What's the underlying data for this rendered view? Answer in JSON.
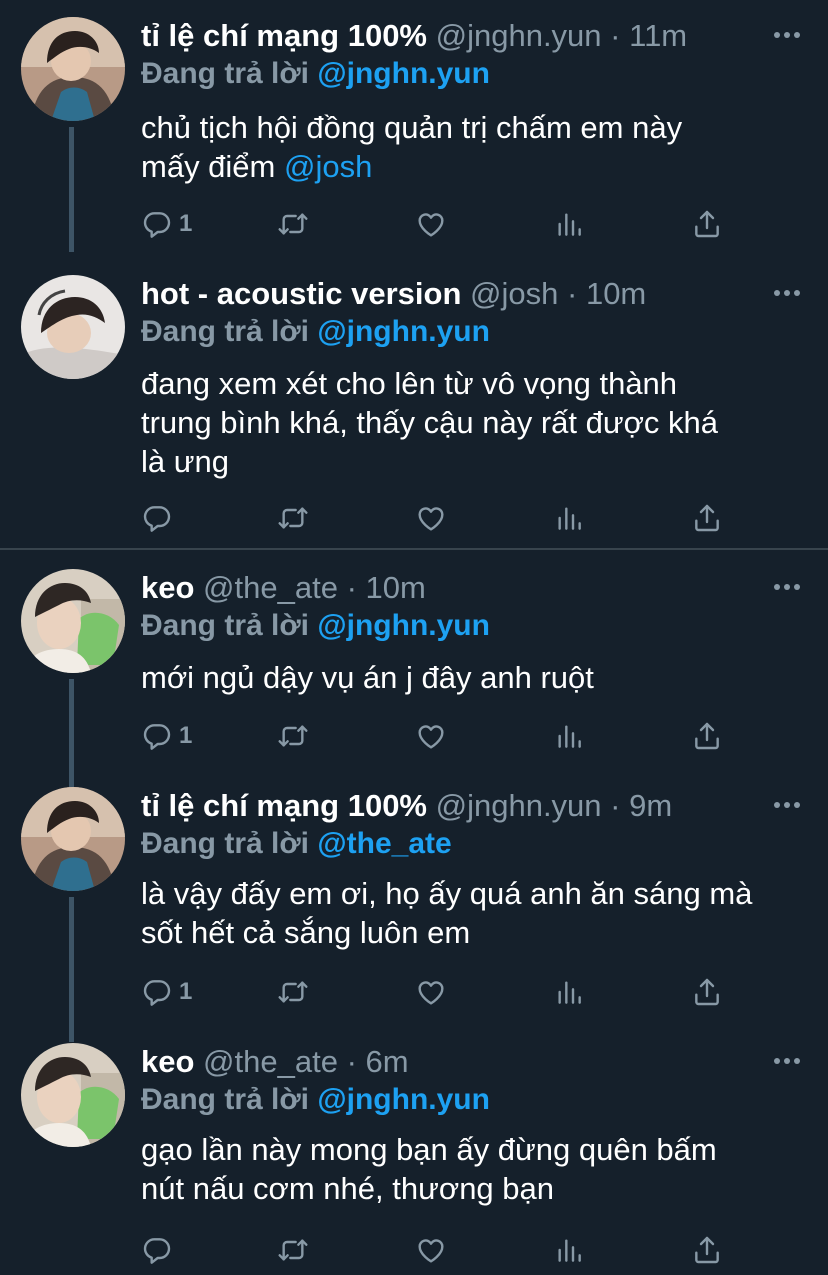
{
  "tweets": [
    {
      "name": "tỉ lệ chí mạng 100%",
      "handle": "@jnghn.yun",
      "time": "11m",
      "reply_prefix": "Đang trả lời",
      "reply_to": "@jnghn.yun",
      "body_lines": [
        "chủ tịch hội đồng quản trị chấm em này",
        "mấy điểm"
      ],
      "body_mention": "@josh",
      "reply_count": "1"
    },
    {
      "name": "hot - acoustic version",
      "handle": "@josh",
      "time": "10m",
      "reply_prefix": "Đang trả lời",
      "reply_to": "@jnghn.yun",
      "body_lines": [
        "đang xem xét cho lên từ vô vọng thành",
        "trung bình khá, thấy cậu này rất được khá",
        "là ưng"
      ],
      "reply_count": ""
    },
    {
      "name": "keo",
      "handle": "@the_ate",
      "time": "10m",
      "reply_prefix": "Đang trả lời",
      "reply_to": "@jnghn.yun",
      "body_lines": [
        "mới ngủ dậy vụ án j đây anh ruột"
      ],
      "reply_count": "1"
    },
    {
      "name": "tỉ lệ chí mạng 100%",
      "handle": "@jnghn.yun",
      "time": "9m",
      "reply_prefix": "Đang trả lời",
      "reply_to": "@the_ate",
      "body_lines": [
        "là vậy đấy em ơi, họ ấy quá anh ăn sáng mà",
        "sốt hết cả sắng luôn em"
      ],
      "reply_count": "1"
    },
    {
      "name": "keo",
      "handle": "@the_ate",
      "time": "6m",
      "reply_prefix": "Đang trả lời",
      "reply_to": "@jnghn.yun",
      "body_lines": [
        "gạo lần này mong bạn ấy đừng quên bấm",
        "nút nấu cơm nhé, thương bạn"
      ],
      "reply_count": ""
    }
  ],
  "separator": "·",
  "icons": [
    "reply-icon",
    "retweet-icon",
    "like-icon",
    "analytics-icon",
    "share-icon",
    "more-icon"
  ],
  "colors": {
    "background": "#15202b",
    "accent": "#1da1f2",
    "muted": "#8899a6",
    "divider": "#38444d"
  }
}
